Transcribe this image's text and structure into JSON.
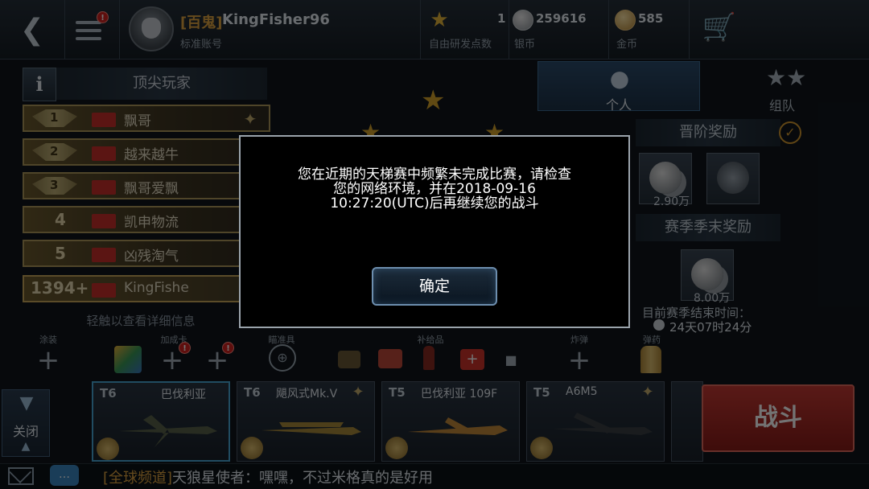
{
  "header": {
    "back_label": "<",
    "menu_badge": "!",
    "clan_tag": "[百鬼]",
    "player_name": "KingFisher96",
    "account_type": "标准账号",
    "research_points": {
      "value": "1",
      "label": "自由研发点数"
    },
    "silver": {
      "value": "259616",
      "label": "银币"
    },
    "gold": {
      "value": "585",
      "label": "金币"
    }
  },
  "leaderboard": {
    "info_label": "i",
    "title": "顶尖玩家",
    "rows": [
      {
        "rank": "1",
        "name": "飘哥"
      },
      {
        "rank": "2",
        "name": "越来越牛"
      },
      {
        "rank": "3",
        "name": "飘哥爱飘"
      },
      {
        "rank": "4",
        "name": "凯申物流"
      },
      {
        "rank": "5",
        "name": "凶残淘气"
      }
    ],
    "me": {
      "rank": "1394+",
      "name": "KingFishe"
    },
    "hint": "轻触以查看详细信息"
  },
  "rewards": {
    "tab_personal": "个人",
    "tab_team": "组队",
    "advance_title": "晋阶奖励",
    "advance_value": "2.90万",
    "season_title": "赛季季末奖励",
    "season_value": "8.00万",
    "season_end_label": "目前赛季结束时间：",
    "season_end_time": "24天07时24分"
  },
  "loadout": {
    "labels": [
      "涂装",
      "加成卡",
      "瞄准具",
      "补给品",
      "炸弹",
      "弹药"
    ],
    "badges": [
      "!",
      "!"
    ]
  },
  "planes": [
    {
      "tier": "T6",
      "name": "巴伐利亚",
      "selected": true
    },
    {
      "tier": "T6",
      "name": "飓风式Mk.V",
      "selected": false
    },
    {
      "tier": "T5",
      "name": "巴伐利亚 109F",
      "selected": false
    },
    {
      "tier": "T5",
      "name": "A6M5",
      "selected": false
    }
  ],
  "filter": {
    "label": "关闭"
  },
  "battle_button": "战斗",
  "chat": {
    "channel": "[全球频道]",
    "message": "天狼星使者：嘿嘿，不过米格真的是好用"
  },
  "modal": {
    "line1": "您在近期的天梯赛中频繁未完成比赛，请检查",
    "line2": "您的网络环境，并在2018-09-16",
    "line3": "10:27:20(UTC)后再继续您的战斗",
    "confirm_label": "确定"
  },
  "colors": {
    "accent_gold": "#e0a440",
    "battle_red": "#c63a34",
    "selected_blue": "#4aa8d8"
  }
}
